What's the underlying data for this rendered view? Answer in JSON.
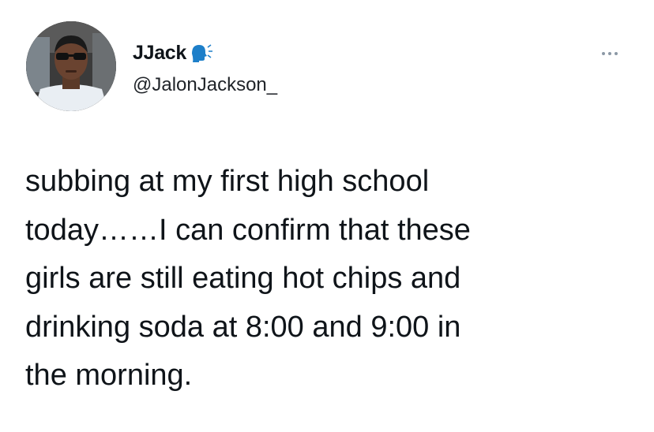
{
  "author": {
    "display_name": "JJack",
    "handle": "@JalonJackson_",
    "avatar_icon": "profile-photo",
    "badge_icon": "speaking-head-icon"
  },
  "menu": {
    "icon": "more-options-icon"
  },
  "tweet": {
    "lines": [
      "subbing at my first high school",
      "today……I can confirm that these",
      "girls are still eating hot chips and",
      "drinking soda at 8:00 and 9:00 in",
      "the morning."
    ]
  },
  "colors": {
    "text": "#0f1419",
    "muted": "#8b98a5",
    "badge": "#1d7fc9"
  }
}
